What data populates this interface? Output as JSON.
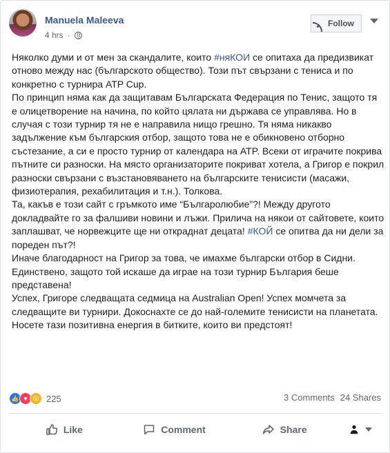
{
  "post": {
    "author": "Manuela Maleeva",
    "time": "4 hrs",
    "audience_icon": "globe-icon",
    "follow_label": "Follow",
    "paragraphs": [
      [
        "Няколко думи и от мен за скандалите, които ",
        {
          "tag": "#няКОИ"
        },
        " се опитаха да предизвикат отново между нас (българското общество). Този път свързани с тениса и по конкретно с турнира ATP Cup."
      ],
      [
        "По принцип няма как да защитавам Българската Федерация по Тенис, защото тя е олицетворение на начина, по който цялата ни държава се управлява. Но в случая с този турнир тя не е направила нищо грешно. Тя няма никакво задължение към българския отбор, защото това не е обикновено отборно състезание, а си е просто турнир от календара на ATP. Всеки от играчите покрива пътните си разноски. На място организаторите покриват хотела, а Григор е покрил разноски свързани с възстановяването на българските тенисисти (масажи, физиотерапия, рехабилитация и т.н.). Толкова."
      ],
      [
        "Та, какъв е този сайт с гръмкото име “Българолюбие”?! Между другото докладвайте го за фалшиви новини и лъжи. Прилича на някои от сайтовете, които заплашват, че норвежците ще ни откраднат децата! ",
        {
          "tag": "#КОЙ"
        },
        " се опитва да ни дели за пореден път?!"
      ],
      [
        "Иначе благодарност на Григор за това, че имахме български отбор в Сидни. Единствено, защото той искаше да играе на този турнир България беше представена!"
      ],
      [
        "Успех, Григоре следващата седмица на Australian Open! Успех момчета за следващите ви турнири. Докоснахте се до най-големите тенисисти на планетата. Носете тази позитивна енергия в битките, които ви предстоят!"
      ]
    ]
  },
  "stats": {
    "reaction_count": "225",
    "comments": "3 Comments",
    "shares": "24 Shares",
    "reaction_icons": [
      "like-icon",
      "love-icon",
      "wow-icon"
    ]
  },
  "actions": {
    "like": "Like",
    "comment": "Comment",
    "share": "Share"
  },
  "colors": {
    "link": "#385898",
    "like": "#2078f4",
    "love": "#f33e58",
    "wow": "#f7b125"
  }
}
